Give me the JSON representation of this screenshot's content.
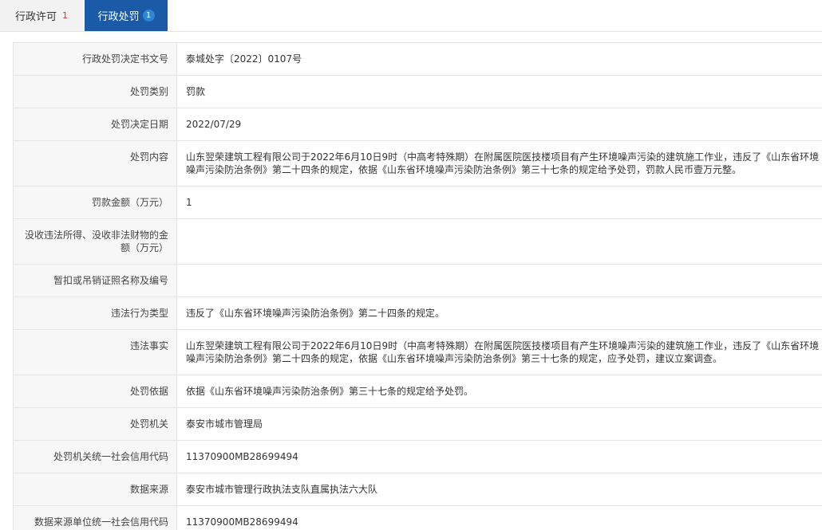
{
  "tabs": [
    {
      "label": "行政许可",
      "count": "1"
    },
    {
      "label": "行政处罚",
      "count": "1"
    }
  ],
  "rows": [
    {
      "label": "行政处罚决定书文号",
      "value": "泰城处字〔2022〕0107号"
    },
    {
      "label": "处罚类别",
      "value": "罚款"
    },
    {
      "label": "处罚决定日期",
      "value": "2022/07/29"
    },
    {
      "label": "处罚内容",
      "value": "山东翌荣建筑工程有限公司于2022年6月10日9时（中高考特殊期）在附属医院医技楼项目有产生环境噪声污染的建筑施工作业，违反了《山东省环境噪声污染防治条例》第二十四条的规定，依据《山东省环境噪声污染防治条例》第三十七条的规定给予处罚，罚款人民币壹万元整。"
    },
    {
      "label": "罚款金额（万元）",
      "value": "1"
    },
    {
      "label": "没收违法所得、没收非法财物的金额（万元）",
      "value": ""
    },
    {
      "label": "暂扣或吊销证照名称及编号",
      "value": ""
    },
    {
      "label": "违法行为类型",
      "value": "违反了《山东省环境噪声污染防治条例》第二十四条的规定。"
    },
    {
      "label": "违法事实",
      "value": "山东翌荣建筑工程有限公司于2022年6月10日9时（中高考特殊期）在附属医院医技楼项目有产生环境噪声污染的建筑施工作业，违反了《山东省环境噪声污染防治条例》第二十四条的规定，依据《山东省环境噪声污染防治条例》第三十七条的规定，应予处罚，建议立案调查。"
    },
    {
      "label": "处罚依据",
      "value": "依据《山东省环境噪声污染防治条例》第三十七条的规定给予处罚。"
    },
    {
      "label": "处罚机关",
      "value": "泰安市城市管理局"
    },
    {
      "label": "处罚机关统一社会信用代码",
      "value": "11370900MB28699494"
    },
    {
      "label": "数据来源",
      "value": "泰安市城市管理行政执法支队直属执法六大队"
    },
    {
      "label": "数据来源单位统一社会信用代码",
      "value": "11370900MB28699494"
    }
  ]
}
